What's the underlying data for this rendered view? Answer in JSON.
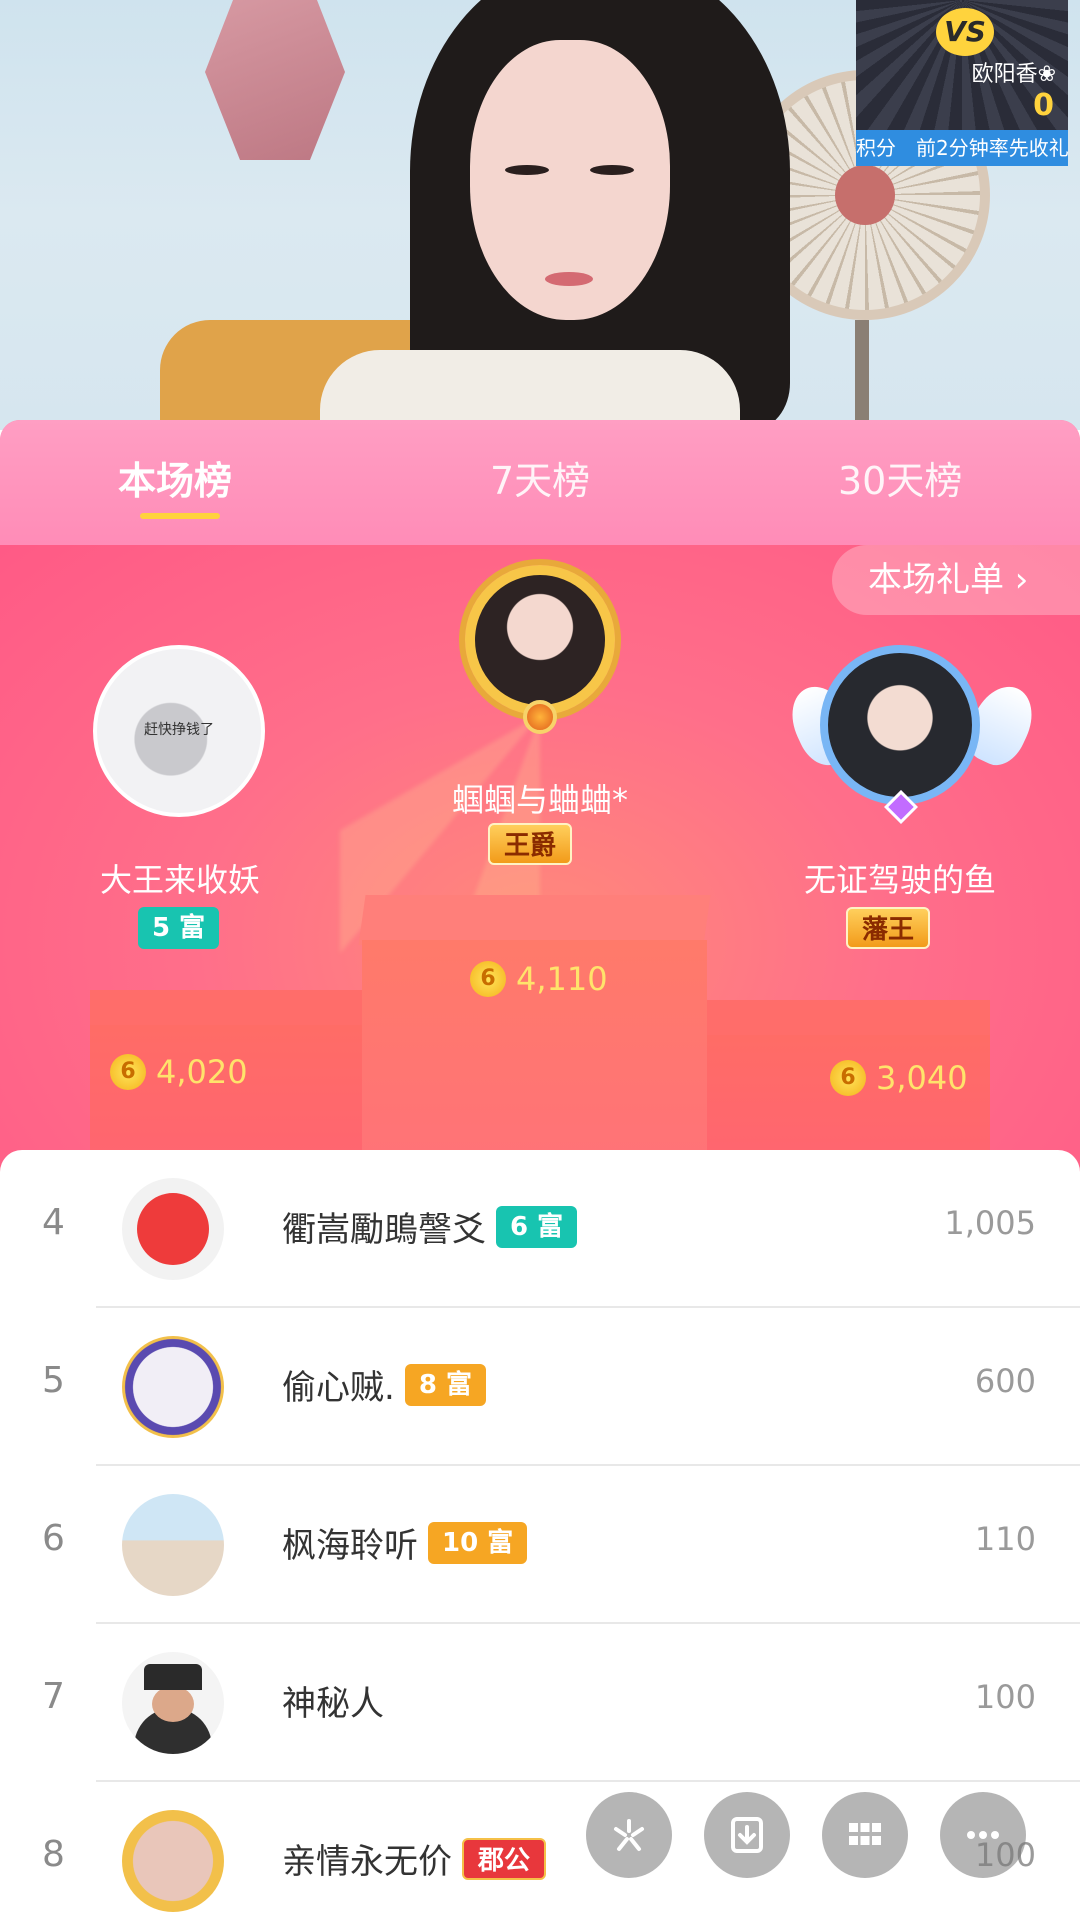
{
  "vs": {
    "badge": "VS",
    "opponent_name": "欧阳香❀",
    "opponent_score": "0",
    "ticker": "积分　前2分钟率先收礼"
  },
  "tabs": [
    {
      "label": "本场榜",
      "active": true
    },
    {
      "label": "7天榜",
      "active": false
    },
    {
      "label": "30天榜",
      "active": false
    }
  ],
  "gift_list_label": "本场礼单 ›",
  "podium": {
    "first": {
      "name": "蝈蝈与蛐蛐*",
      "badge": "王爵",
      "score": "4,110",
      "rank": "1"
    },
    "second": {
      "name": "大王来收妖",
      "badge": "5 富",
      "score": "4,020",
      "rank": "2",
      "avatar_caption": "赶快挣钱了"
    },
    "third": {
      "name": "无证驾驶的鱼",
      "badge": "藩王",
      "score": "3,040",
      "rank": "3"
    }
  },
  "coin_glyph": "6",
  "list": [
    {
      "rank": "4",
      "name": "衢嵩勵鴡謦爻",
      "badge": "6 富",
      "badge_color": "#18c4b0",
      "value": "1,005"
    },
    {
      "rank": "5",
      "name": "偷心贼.",
      "badge": "8 富",
      "badge_color": "#f6a623",
      "value": "600"
    },
    {
      "rank": "6",
      "name": "枫海聆听",
      "badge": "10 富",
      "badge_color": "#f6a623",
      "value": "110"
    },
    {
      "rank": "7",
      "name": "神秘人",
      "badge": "",
      "badge_color": "",
      "value": "100"
    },
    {
      "rank": "8",
      "name": "亲情永无价",
      "badge": "郡公",
      "badge_color": "#e8373c",
      "value": "100"
    }
  ],
  "fabs": [
    "share-icon",
    "download-icon",
    "grid-icon",
    "more-icon"
  ]
}
